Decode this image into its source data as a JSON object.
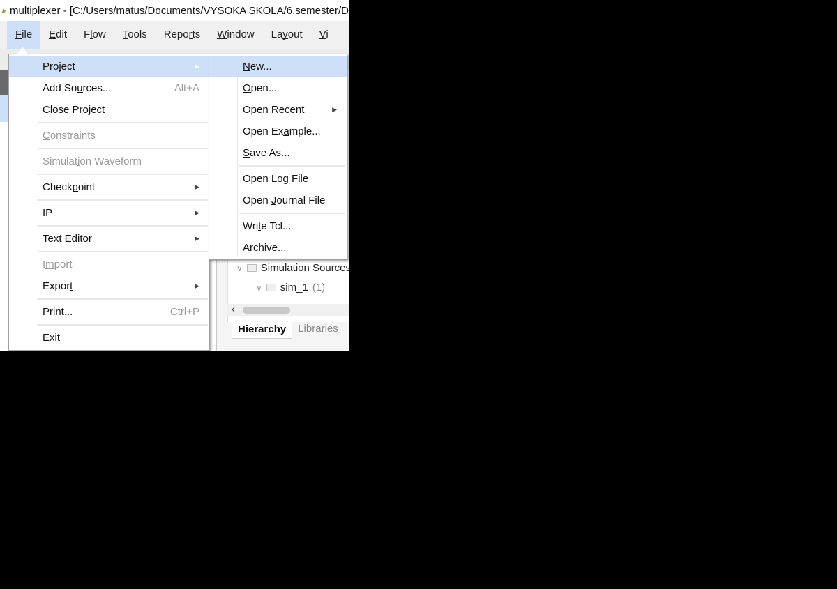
{
  "window": {
    "title": "multiplexer - [C:/Users/matus/Documents/VYSOKA SKOLA/6.semester/D"
  },
  "menubar": [
    {
      "label": "File",
      "mnemonic": 0,
      "active": true
    },
    {
      "label": "Edit",
      "mnemonic": 0
    },
    {
      "label": "Flow",
      "mnemonic": 1
    },
    {
      "label": "Tools",
      "mnemonic": 0
    },
    {
      "label": "Reports",
      "mnemonic": 4
    },
    {
      "label": "Window",
      "mnemonic": 0
    },
    {
      "label": "Layout",
      "mnemonic": 2
    },
    {
      "label": "Vi",
      "mnemonic": 0
    }
  ],
  "file_menu": [
    {
      "label": "Project",
      "mnemonic": 3,
      "submenu": true,
      "highlighted": true
    },
    {
      "label": "Add Sources...",
      "mnemonic": 6,
      "shortcut": "Alt+A"
    },
    {
      "label": "Close Project",
      "mnemonic": 0
    },
    {
      "separator": true
    },
    {
      "label": "Constraints",
      "mnemonic": 0,
      "submenu": true,
      "disabled": true
    },
    {
      "separator": true
    },
    {
      "label": "Simulation Waveform",
      "mnemonic": 7,
      "submenu": true,
      "disabled": true
    },
    {
      "separator": true
    },
    {
      "label": "Checkpoint",
      "mnemonic": 5,
      "submenu": true
    },
    {
      "separator": true
    },
    {
      "label": "IP",
      "mnemonic": 0,
      "submenu": true
    },
    {
      "separator": true
    },
    {
      "label": "Text Editor",
      "mnemonic": 6,
      "submenu": true
    },
    {
      "separator": true
    },
    {
      "label": "Import",
      "mnemonic": 1,
      "submenu": true,
      "disabled": true
    },
    {
      "label": "Export",
      "mnemonic": 5,
      "submenu": true
    },
    {
      "separator": true
    },
    {
      "label": "Print...",
      "mnemonic": 0,
      "shortcut": "Ctrl+P"
    },
    {
      "separator": true
    },
    {
      "label": "Exit",
      "mnemonic": 1
    }
  ],
  "project_submenu": [
    {
      "label": "New...",
      "mnemonic": 0,
      "highlighted": true
    },
    {
      "label": "Open...",
      "mnemonic": 0
    },
    {
      "label": "Open Recent",
      "mnemonic": 5,
      "submenu": true
    },
    {
      "label": "Open Example...",
      "mnemonic": 7
    },
    {
      "label": "Save As...",
      "mnemonic": 0
    },
    {
      "separator": true
    },
    {
      "label": "Open Log File",
      "mnemonic": 7
    },
    {
      "label": "Open Journal File",
      "mnemonic": 5
    },
    {
      "separator": true
    },
    {
      "label": "Write Tcl...",
      "mnemonic": 3
    },
    {
      "label": "Archive...",
      "mnemonic": 3
    }
  ],
  "sources_tree": {
    "rows": [
      {
        "label": "Simulation Sources",
        "count": ""
      },
      {
        "label": "sim_1",
        "count": "(1)"
      }
    ],
    "tabs": [
      {
        "label": "Hierarchy",
        "active": true
      },
      {
        "label": "Libraries"
      }
    ]
  },
  "colors": {
    "highlight": "#cde0f7",
    "menubar": "#f0f0f0",
    "disabled": "#9a9a9a"
  }
}
